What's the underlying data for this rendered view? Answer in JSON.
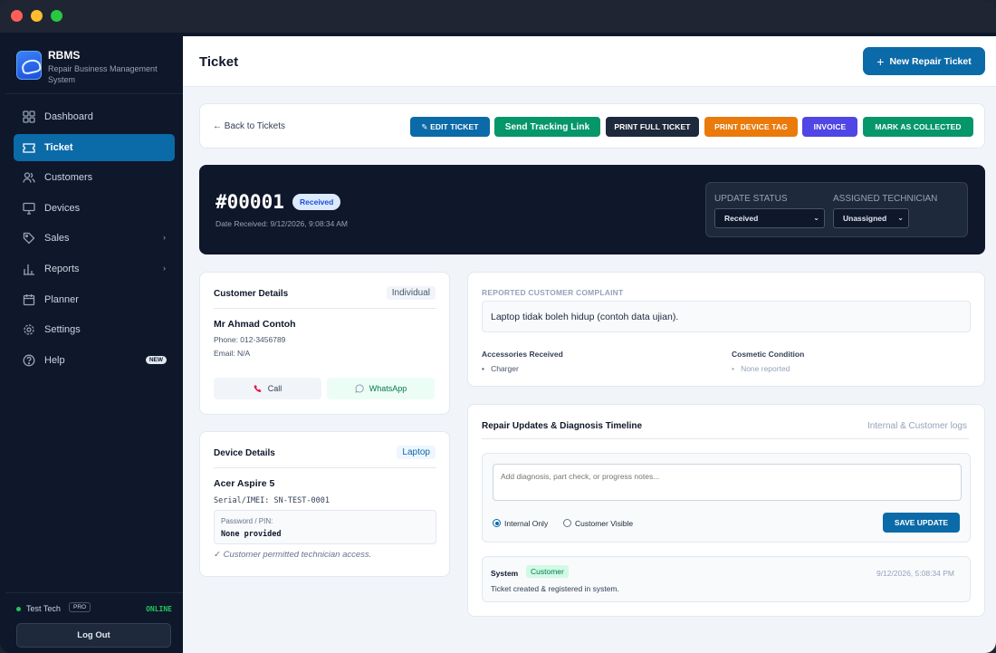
{
  "sidebar": {
    "brand_name": "RBMS",
    "brand_subtitle": "Repair Business Management System",
    "items": [
      {
        "label": "Dashboard",
        "icon": "grid-icon"
      },
      {
        "label": "Ticket",
        "icon": "ticket-icon",
        "active": true
      },
      {
        "label": "Customers",
        "icon": "users-icon"
      },
      {
        "label": "Devices",
        "icon": "monitor-icon"
      },
      {
        "label": "Sales",
        "icon": "tag-icon",
        "chevron": "›"
      },
      {
        "label": "Reports",
        "icon": "bar-chart-icon",
        "chevron": "›"
      },
      {
        "label": "Planner",
        "icon": "calendar-icon"
      },
      {
        "label": "Settings",
        "icon": "gear-icon"
      },
      {
        "label": "Help",
        "icon": "help-circle-icon",
        "badge": "NEW"
      }
    ],
    "user": {
      "name": "Test Tech",
      "role_badge": "PRO",
      "status": "ONLINE"
    },
    "logout_label": "Log Out"
  },
  "header": {
    "title": "Ticket",
    "new_ticket_label": "New Repair Ticket"
  },
  "actions": {
    "back_label": "← Back to Tickets",
    "buttons": [
      {
        "label": "Edit Ticket",
        "color": "#0b6aa8"
      },
      {
        "label": "Send Tracking Link",
        "color": "#059669"
      },
      {
        "label": "Print Full Ticket",
        "color": "#1e293b"
      },
      {
        "label": "Print Device Tag",
        "color": "#ea7a0c"
      },
      {
        "label": "Invoice",
        "color": "#4f46e5"
      },
      {
        "label": "Mark As Collected",
        "color": "#059669"
      }
    ]
  },
  "ticket": {
    "number": "#00001",
    "status_badge": "Received",
    "date_received": "Date Received: 9/12/2026, 9:08:34 AM",
    "update_status_label": "Update Status",
    "update_status_value": "Received",
    "technician_label": "Assigned Technician",
    "technician_value": "Unassigned"
  },
  "customer": {
    "section_title": "Customer Details",
    "type": "Individual",
    "name": "Mr Ahmad Contoh",
    "phone": "Phone: 012-3456789",
    "email": "Email: N/A",
    "call_label": "Call",
    "whatsapp_label": "WhatsApp"
  },
  "device": {
    "section_title": "Device Details",
    "type": "Laptop",
    "name": "Acer Aspire 5",
    "serial": "Serial/IMEI: SN-TEST-0001",
    "password_label": "Password / PIN:",
    "password_value": "None provided",
    "permission_note": "✓ Customer permitted technician access."
  },
  "complaint": {
    "label": "Reported Customer Complaint",
    "text": "Laptop tidak boleh hidup (contoh data ujian).",
    "accessories_title": "Accessories Received",
    "accessories_item": "Charger",
    "cosmetic_title": "Cosmetic Condition",
    "cosmetic_item": "None reported"
  },
  "timeline": {
    "title": "Repair Updates & Diagnosis Timeline",
    "subtitle": "Internal & Customer logs",
    "note_placeholder": "Add diagnosis, part check, or progress notes...",
    "radio_internal": "Internal Only",
    "radio_customer": "Customer Visible",
    "save_label": "SAVE UPDATE",
    "entries": [
      {
        "author": "System",
        "visibility": "Customer",
        "time": "9/12/2026, 5:08:34 PM",
        "text": "Ticket created & registered in system."
      }
    ]
  }
}
